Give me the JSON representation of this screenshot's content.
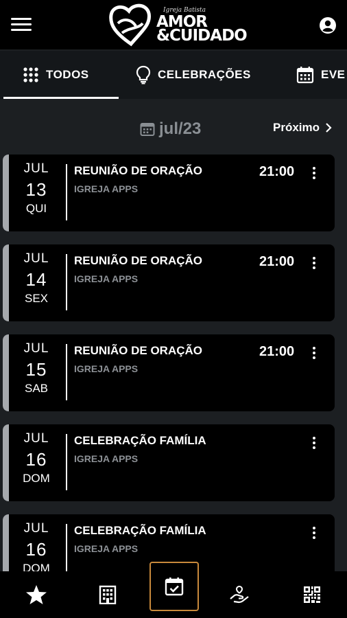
{
  "header": {
    "logo_small": "Igreja Batista",
    "logo_line1": "AMOR",
    "logo_line2": "&CUIDADO",
    "menu_icon": "hamburger-menu-icon",
    "account_icon": "account-circle-icon"
  },
  "tabs": [
    {
      "label": "TODOS",
      "icon": "grid-icon",
      "active": true
    },
    {
      "label": "CELEBRAÇÕES",
      "icon": "lightbulb-icon",
      "active": false
    },
    {
      "label": "EVE",
      "icon": "calendar-icon",
      "active": false
    }
  ],
  "month_nav": {
    "month": "jul/23",
    "next_label": "Próximo"
  },
  "events": [
    {
      "month": "JUL",
      "day": "13",
      "weekday": "QUI",
      "title": "REUNIÃO DE ORAÇÃO",
      "subtitle": "IGREJA APPS",
      "time": "21:00"
    },
    {
      "month": "JUL",
      "day": "14",
      "weekday": "SEX",
      "title": "REUNIÃO DE ORAÇÃO",
      "subtitle": "IGREJA APPS",
      "time": "21:00"
    },
    {
      "month": "JUL",
      "day": "15",
      "weekday": "SAB",
      "title": "REUNIÃO DE ORAÇÃO",
      "subtitle": "IGREJA APPS",
      "time": "21:00"
    },
    {
      "month": "JUL",
      "day": "16",
      "weekday": "DOM",
      "title": "CELEBRAÇÃO FAMÍLIA",
      "subtitle": "IGREJA APPS",
      "time": ""
    },
    {
      "month": "JUL",
      "day": "16",
      "weekday": "DOM",
      "title": "CELEBRAÇÃO FAMÍLIA",
      "subtitle": "IGREJA APPS",
      "time": ""
    }
  ],
  "bottom_nav": [
    {
      "icon": "star-icon",
      "active": false
    },
    {
      "icon": "building-icon",
      "active": false
    },
    {
      "icon": "calendar-check-icon",
      "active": true
    },
    {
      "icon": "donation-hand-icon",
      "active": false
    },
    {
      "icon": "qr-code-icon",
      "active": false
    }
  ],
  "colors": {
    "background": "#1c1f22",
    "card": "#000000",
    "card_accent": "#a6a9ad",
    "subtitle": "#8d9196",
    "active_nav_border": "#c98a3c"
  }
}
